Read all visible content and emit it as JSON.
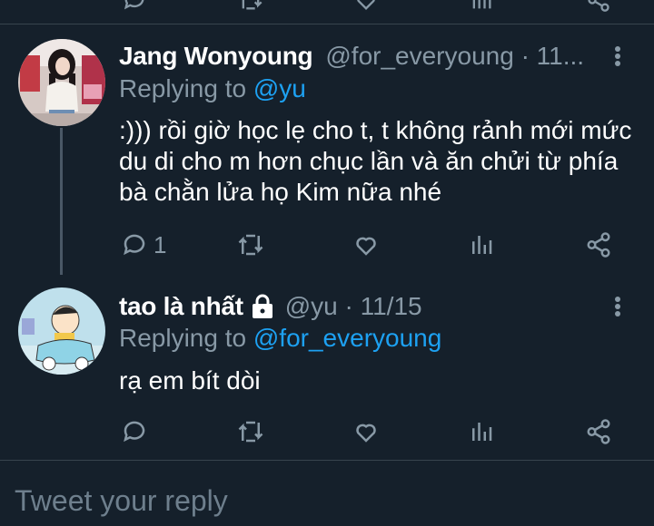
{
  "tweets": [
    {
      "name": "Jang Wonyoung",
      "handle": "@for_everyoung · 11...",
      "replying_prefix": "Replying to ",
      "replying_to": "@yu",
      "text": ":))) rồi giờ học lẹ cho t, t không rảnh mới mức du di cho m hơn chục lần và ăn chửi từ phía bà chằn lửa họ Kim nữa nhé",
      "reply_count": "1"
    },
    {
      "name": "tao là nhất",
      "handle": "@yu · 11/15",
      "replying_prefix": "Replying to ",
      "replying_to": "@for_everyoung",
      "text": "rạ em bít dòi",
      "reply_count": ""
    }
  ],
  "compose": {
    "placeholder": "Tweet your reply"
  },
  "colors": {
    "background": "#15202b",
    "secondary_text": "#8899a6",
    "link": "#1da1f2",
    "divider": "#38444d"
  },
  "icons": [
    "reply-icon",
    "retweet-icon",
    "like-icon",
    "analytics-icon",
    "share-icon",
    "more-icon",
    "lock-icon"
  ]
}
